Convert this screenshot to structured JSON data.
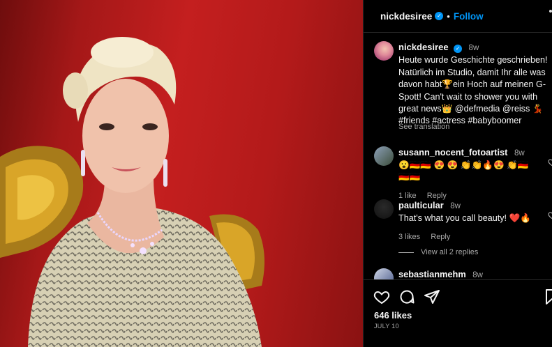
{
  "post": {
    "author": "nickdesiree",
    "follow_label": "Follow",
    "separator": "•",
    "caption": {
      "username": "nickdesiree",
      "time": "8w",
      "text": "Heute wurde Geschichte geschrieben! Natürlich im Studio, damit Ihr alle was davon habt🏆ein Hoch auf meinen G-Spott! Can't wait to shower you with great news👑 @defmedia @reiss 💃 #friends #actress #babyboomer",
      "see_translation": "See translation"
    },
    "comments": [
      {
        "username": "susann_nocent_fotoartist",
        "time": "8w",
        "text": "😮🇩🇪🇩🇪 😍 😍 👏👏🔥😍 👏🇩🇪🇩🇪🇩🇪",
        "likes": "1 like",
        "reply": "Reply"
      },
      {
        "username": "paulticular",
        "time": "8w",
        "text": "That's what you call beauty! ❤️🔥",
        "likes": "3 likes",
        "reply": "Reply"
      },
      {
        "username": "sebastianmehm",
        "time": "8w"
      }
    ],
    "view_replies": "View all 2 replies",
    "likes_count": "646 likes",
    "date": "JULY 10",
    "colors": {
      "accent": "#0095f6",
      "background": "#000000",
      "secondary_text": "#a8a8a8"
    },
    "icons": [
      "heart-icon",
      "comment-icon",
      "share-icon",
      "bookmark-icon",
      "verified-icon"
    ]
  }
}
